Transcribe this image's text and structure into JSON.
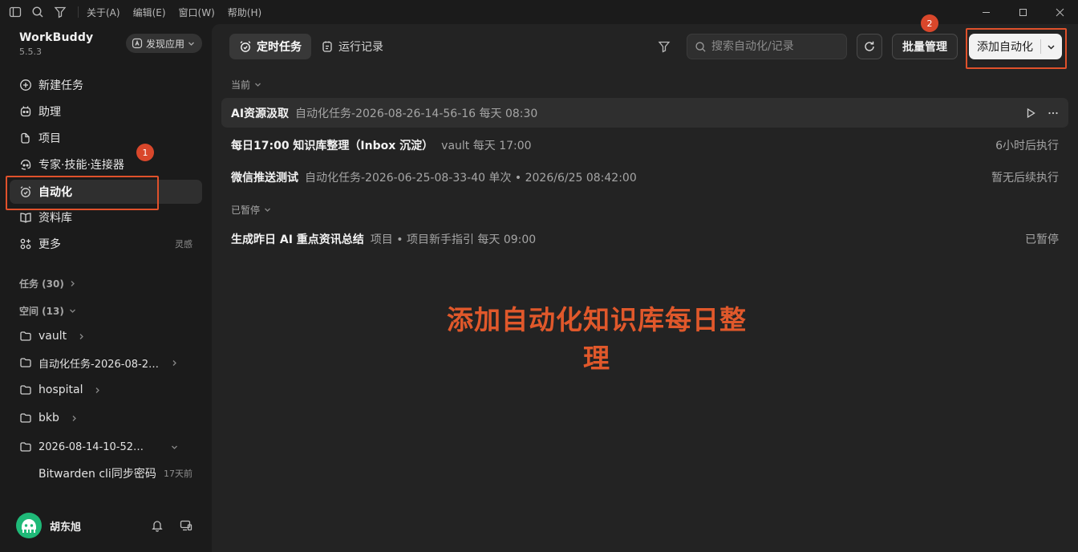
{
  "titlebar": {
    "menus": [
      "关于(A)",
      "编辑(E)",
      "窗口(W)",
      "帮助(H)"
    ],
    "icons": [
      "sidebar-toggle-icon",
      "search-icon",
      "filter-icon"
    ],
    "window_controls": [
      "minimize",
      "maximize",
      "close"
    ]
  },
  "sidebar": {
    "app_name": "WorkBuddy",
    "version": "5.5.3",
    "discover_label": "发现应用",
    "nav": [
      {
        "label": "新建任务",
        "icon": "plus-circle-icon"
      },
      {
        "label": "助理",
        "icon": "assistant-icon"
      },
      {
        "label": "项目",
        "icon": "project-icon"
      },
      {
        "label": "专家·技能·连接器",
        "icon": "expert-icon"
      },
      {
        "label": "自动化",
        "icon": "alarm-clock-icon",
        "active": true
      },
      {
        "label": "资料库",
        "icon": "book-icon"
      },
      {
        "label": "更多",
        "icon": "grid-plus-icon",
        "hint": "灵感"
      }
    ],
    "tasks_section": "任务 (30)",
    "spaces_section": "空间 (13)",
    "spaces": [
      {
        "label": "vault"
      },
      {
        "label": "自动化任务-2026-08-2…"
      },
      {
        "label": "hospital"
      },
      {
        "label": "bkb"
      },
      {
        "label": "2026-08-14-10-52…",
        "expanded": true
      }
    ],
    "sub_items": [
      {
        "label": "Bitwarden cli同步密码",
        "meta": "17天前"
      }
    ],
    "user": {
      "name": "胡东旭",
      "avatar_color": "#1fb978"
    }
  },
  "main": {
    "tabs": [
      {
        "label": "定时任务",
        "icon": "alarm-check-icon",
        "active": true
      },
      {
        "label": "运行记录",
        "icon": "clock-list-icon"
      }
    ],
    "search_placeholder": "搜索自动化/记录",
    "batch_label": "批量管理",
    "add_label": "添加自动化",
    "groups": [
      {
        "label": "当前",
        "tasks": [
          {
            "title": "AI资源汲取",
            "meta": "自动化任务-2026-08-26-14-56-16  每天 08:30",
            "status": ""
          },
          {
            "title": "每日17:00 知识库整理（Inbox 沉淀）",
            "meta": "vault  每天 17:00",
            "status": "6小时后执行"
          },
          {
            "title": "微信推送测试",
            "meta": "自动化任务-2026-06-25-08-33-40  单次 • 2026/6/25 08:42:00",
            "status": "暂无后续执行"
          }
        ]
      },
      {
        "label": "已暂停",
        "tasks": [
          {
            "title": "生成昨日 AI 重点资讯总结",
            "meta": "项目 • 项目新手指引  每天 09:00",
            "status": "已暂停"
          }
        ]
      }
    ]
  },
  "annotations": {
    "text": "添加自动化知识库每日整理",
    "badges": [
      "1",
      "2"
    ],
    "color": "#e0512b"
  }
}
